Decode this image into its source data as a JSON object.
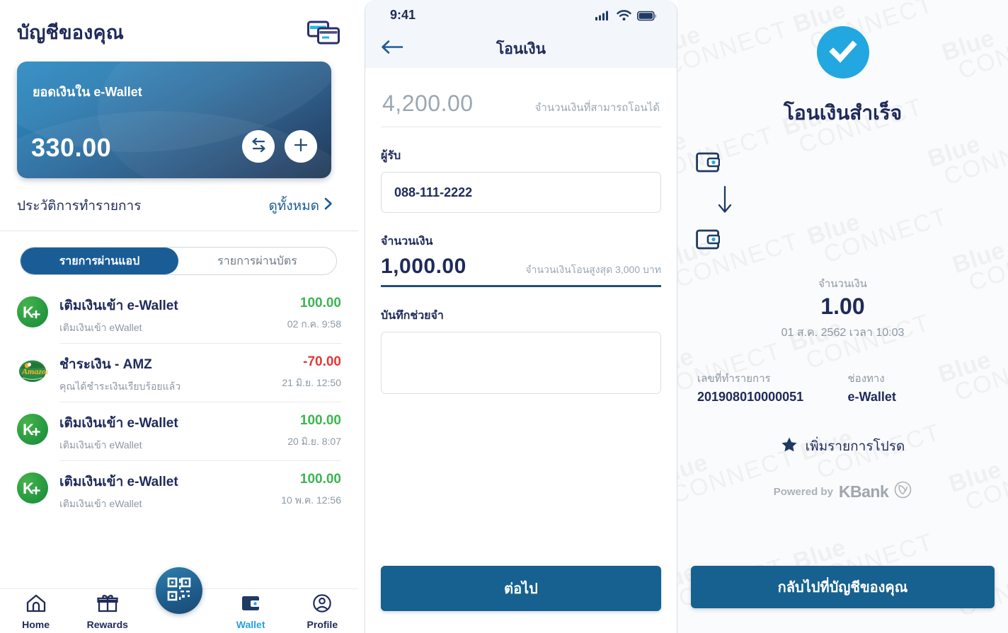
{
  "wallet": {
    "title": "บัญชีของคุณ",
    "cards_icon": "cards-icon",
    "card": {
      "label": "ยอดเงินใน e-Wallet",
      "amount": "330.00",
      "transfer_icon": "transfer-arrows-icon",
      "topup_icon": "plus-icon"
    },
    "history": {
      "title": "ประวัติการทำรายการ",
      "see_all": "ดูทั้งหมด",
      "chevron_icon": "chevron-right-icon"
    },
    "tabs": [
      {
        "label": "รายการผ่านแอป",
        "active": true
      },
      {
        "label": "รายการผ่านบัตร",
        "active": false
      }
    ],
    "transactions": [
      {
        "icon": "kplus-logo-icon",
        "name": "เติมเงินเข้า e-Wallet",
        "desc": "เติมเงินเข้า eWallet",
        "amount": "100.00",
        "sign": "pos",
        "date": "02 ก.ค. 9:58"
      },
      {
        "icon": "amazon-cafe-logo-icon",
        "name": "ชำระเงิน - AMZ",
        "desc": "คุณได้ชำระเงินเรียบร้อยแล้ว",
        "amount": "-70.00",
        "sign": "neg",
        "date": "21 มิ.ย. 12:50"
      },
      {
        "icon": "kplus-logo-icon",
        "name": "เติมเงินเข้า e-Wallet",
        "desc": "เติมเงินเข้า eWallet",
        "amount": "100.00",
        "sign": "pos",
        "date": "20 มิ.ย. 8:07"
      },
      {
        "icon": "kplus-logo-icon",
        "name": "เติมเงินเข้า e-Wallet",
        "desc": "เติมเงินเข้า eWallet",
        "amount": "100.00",
        "sign": "pos",
        "date": "10 พ.ค. 12:56"
      }
    ],
    "nav": [
      {
        "label": "Home",
        "icon": "home-icon",
        "active": false
      },
      {
        "label": "Rewards",
        "icon": "gift-icon",
        "active": false
      },
      {
        "label": "Wallet",
        "icon": "wallet-icon",
        "active": true
      },
      {
        "label": "Profile",
        "icon": "person-circle-icon",
        "active": false
      }
    ],
    "qr_fab_icon": "qr-code-icon"
  },
  "transfer": {
    "status_bar": {
      "time": "9:41",
      "signal_icon": "cellular-signal-icon",
      "wifi_icon": "wifi-icon",
      "battery_icon": "battery-full-icon"
    },
    "header": {
      "title": "โอนเงิน",
      "back_icon": "arrow-left-icon"
    },
    "available": {
      "amount": "4,200.00",
      "label": "จำนวนเงินที่สามารถโอนได้"
    },
    "recipient": {
      "label": "ผู้รับ",
      "value": "088-111-2222",
      "placeholder": "088-111-2222"
    },
    "amount": {
      "label": "จำนวนเงิน",
      "value": "1,000.00",
      "hint": "จำนวนเงินโอนสูงสุด 3,000 บาท"
    },
    "note": {
      "label": "บันทึกช่วยจำ",
      "value": "",
      "placeholder": ""
    },
    "submit_label": "ต่อไป"
  },
  "success": {
    "check_icon": "check-circle-icon",
    "title": "โอนเงินสำเร็จ",
    "watermark": {
      "line1": "Blue",
      "line2": "CONNECT"
    },
    "from_account": {
      "icon": "wallet-square-icon",
      "masked": true
    },
    "arrow_icon": "arrow-down-icon",
    "to_account": {
      "icon": "wallet-square-icon",
      "masked": true
    },
    "amount_label": "จำนวนเงิน",
    "amount_value": "1.00",
    "datetime": "01 ส.ค. 2562 เวลา 10:03",
    "meta": [
      {
        "label": "เลขที่ทำรายการ",
        "value": "201908010000051"
      },
      {
        "label": "ช่องทาง",
        "value": "e-Wallet"
      }
    ],
    "favorite": {
      "icon": "star-icon",
      "label": "เพิ่มรายการโปรด"
    },
    "powered": {
      "prefix": "Powered by",
      "brand": "KBank",
      "logo_icon": "kbank-leaf-icon"
    },
    "back_label": "กลับไปที่บัญชีของคุณ"
  },
  "colors": {
    "brand_navy": "#1f2a5a",
    "brand_blue": "#16618f",
    "accent_cyan": "#22a7e0",
    "positive_green": "#3cb552",
    "negative_red": "#e23a37",
    "muted_gray": "#8c98a4"
  }
}
